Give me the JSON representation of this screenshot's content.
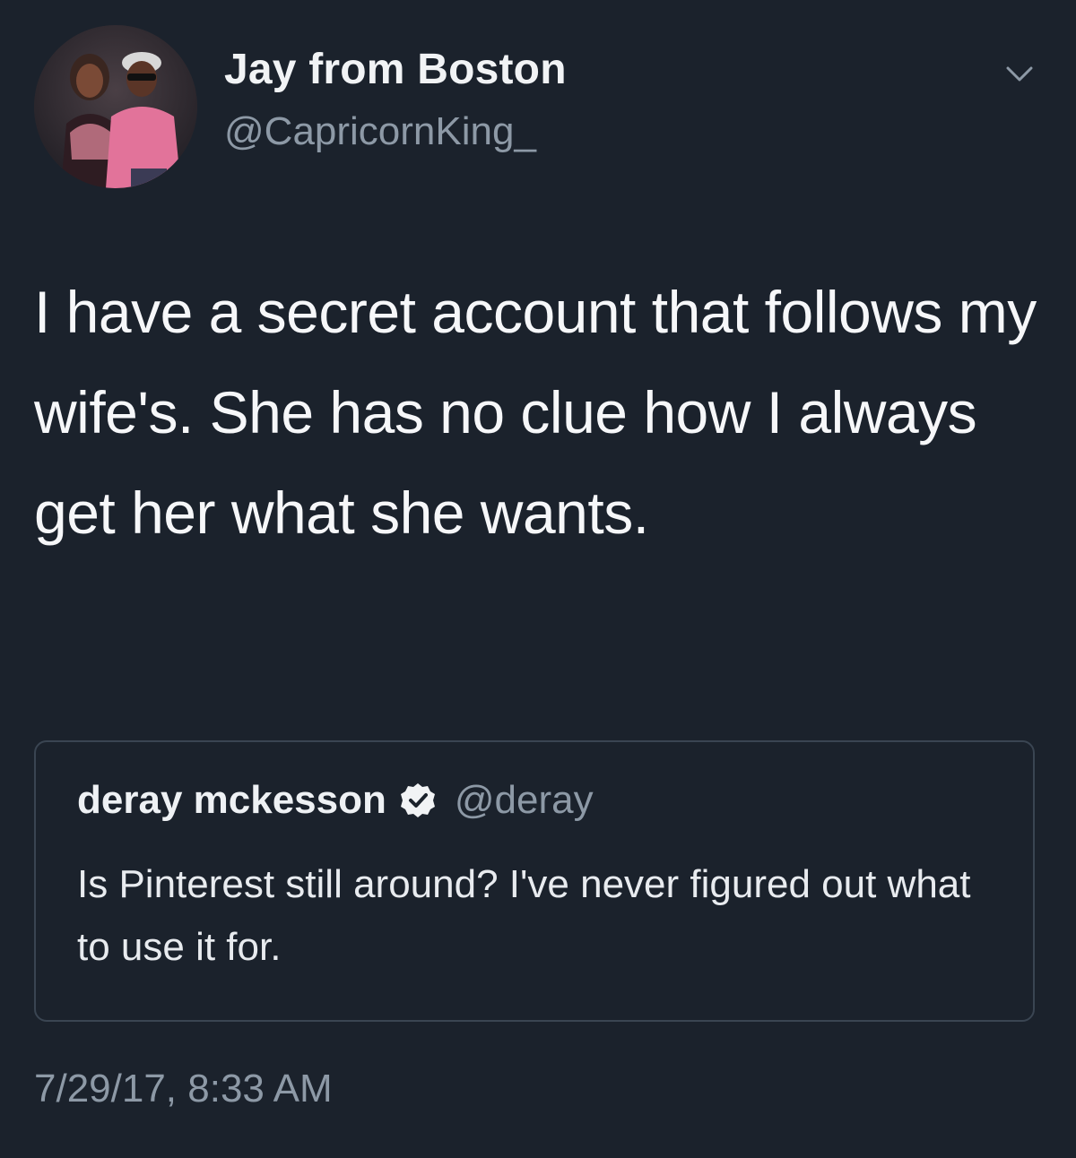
{
  "tweet": {
    "author_name": "Jay from Boston",
    "author_handle": "@CapricornKing_",
    "text": "I have a secret account that follows my wife's. She has no clue how I always get her what she wants.",
    "timestamp": "7/29/17, 8:33 AM",
    "menu_icon": "chevron-down-icon"
  },
  "quoted_tweet": {
    "author_name": "deray mckesson",
    "author_handle": "@deray",
    "verified_icon": "verified-badge-icon",
    "text": "Is Pinterest still around? I've never figured out what to use it for."
  },
  "colors": {
    "background": "#1b222c",
    "primary_text": "#f4f6f8",
    "secondary_text": "#8d99a6",
    "quote_border": "#3a4552"
  }
}
